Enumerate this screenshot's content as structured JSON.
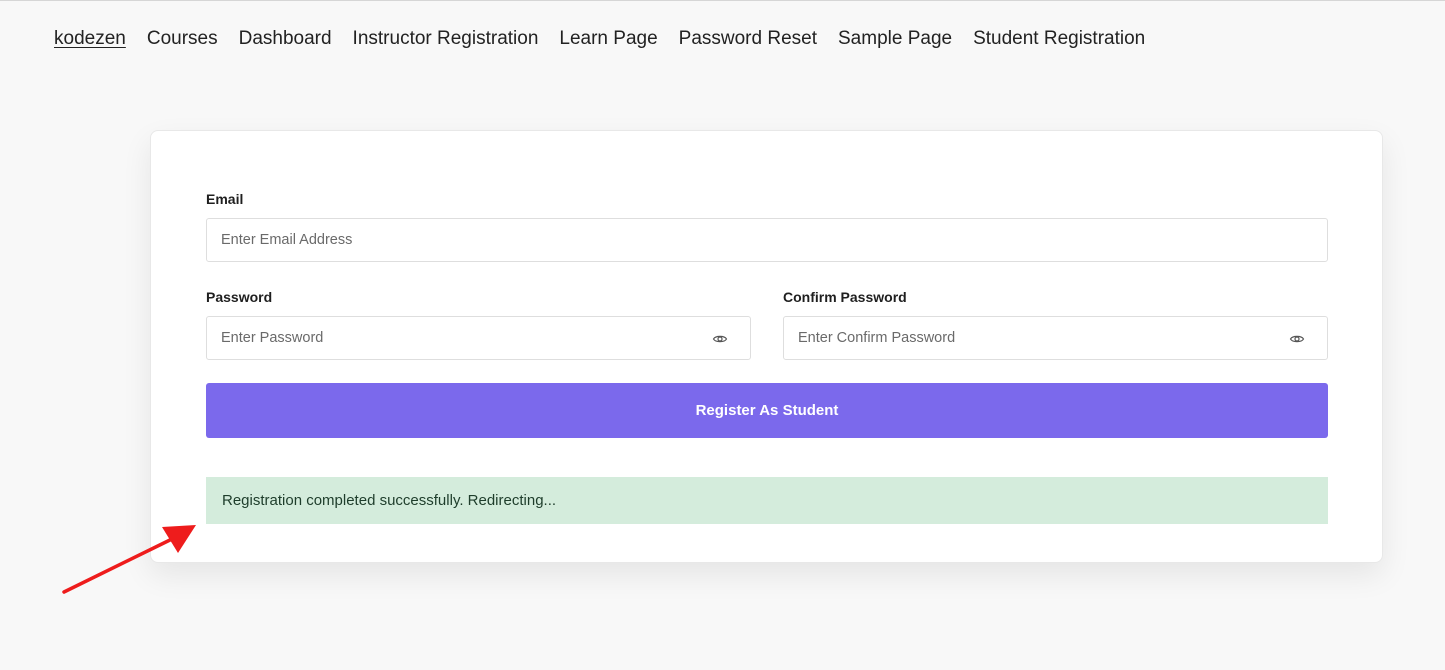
{
  "nav": {
    "site_title": "kodezen",
    "items": [
      {
        "label": "Courses"
      },
      {
        "label": "Dashboard"
      },
      {
        "label": "Instructor Registration"
      },
      {
        "label": "Learn Page"
      },
      {
        "label": "Password Reset"
      },
      {
        "label": "Sample Page"
      },
      {
        "label": "Student Registration"
      }
    ]
  },
  "form": {
    "email_label": "Email",
    "email_placeholder": "Enter Email Address",
    "email_value": "",
    "password_label": "Password",
    "password_placeholder": "Enter Password",
    "password_value": "",
    "confirm_label": "Confirm Password",
    "confirm_placeholder": "Enter Confirm Password",
    "confirm_value": "",
    "submit_label": "Register As Student"
  },
  "alert": {
    "message": "Registration completed successfully. Redirecting..."
  },
  "icons": {
    "password_toggle": "eye-icon",
    "annotation": "red-arrow-icon"
  },
  "colors": {
    "primary_button": "#7b69ec",
    "success_background": "#d4ecdc",
    "annotation_arrow": "#ee1c1c",
    "page_background": "#f8f8f8"
  }
}
